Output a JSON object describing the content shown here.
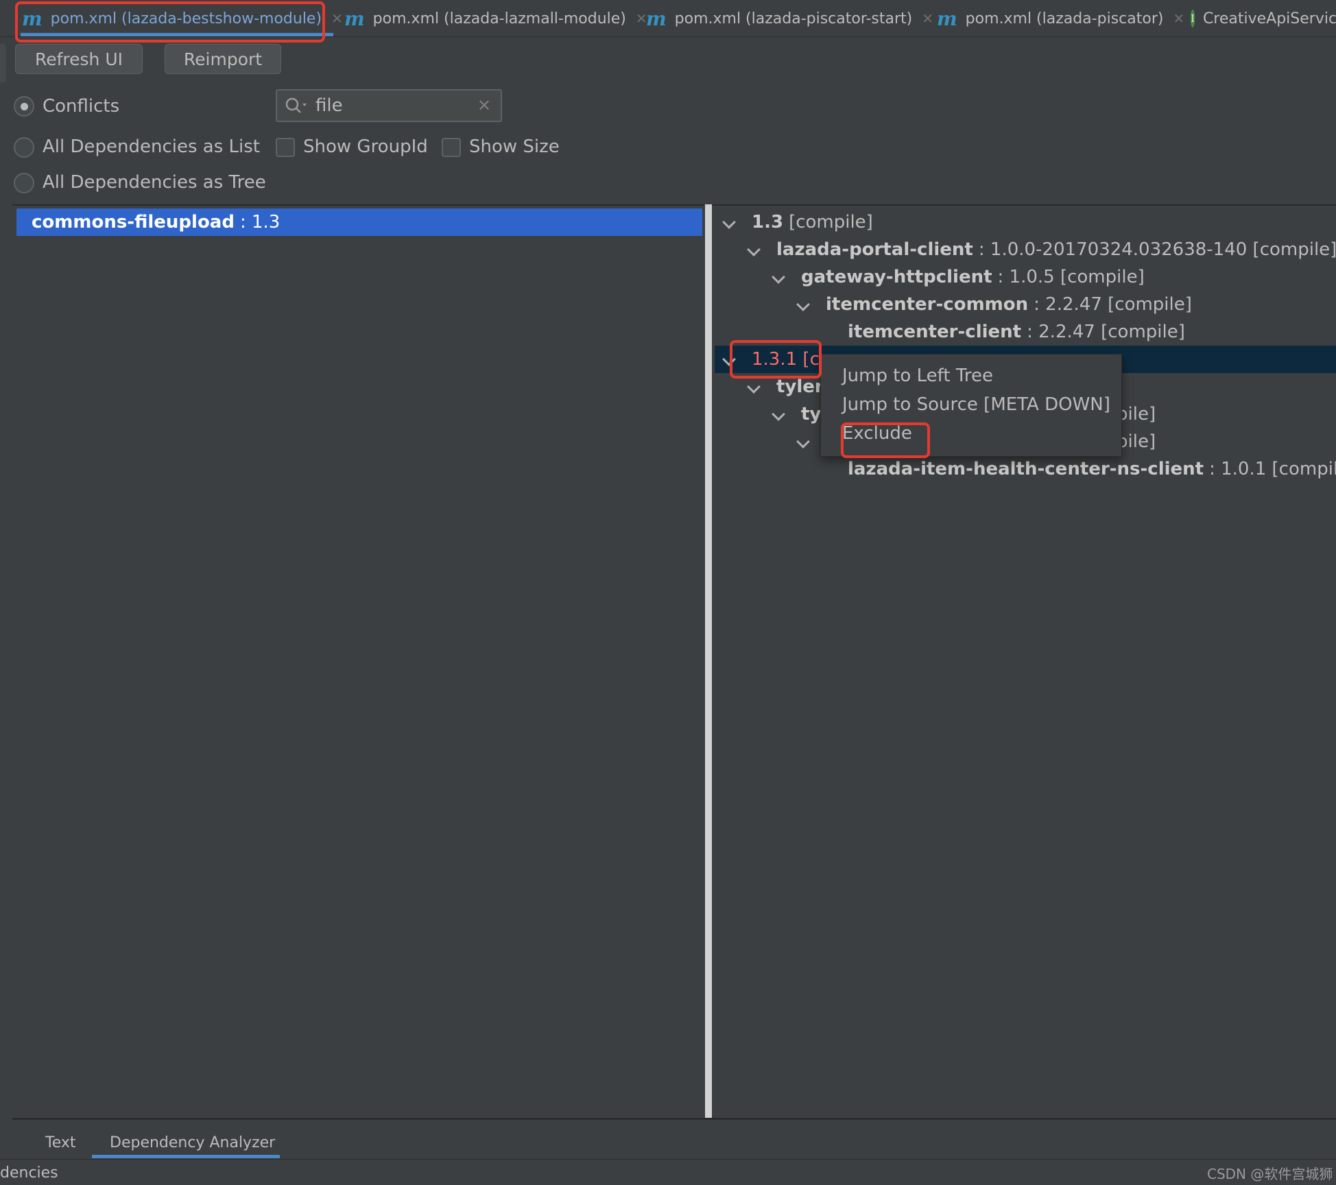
{
  "editor_tabs": [
    {
      "label": "pom.xml (lazada-bestshow-module)",
      "icon": "maven-icon",
      "active": true
    },
    {
      "label": "pom.xml (lazada-lazmall-module)",
      "icon": "maven-icon",
      "active": false
    },
    {
      "label": "pom.xml (lazada-piscator-start)",
      "icon": "maven-icon",
      "active": false
    },
    {
      "label": "pom.xml (lazada-piscator)",
      "icon": "maven-icon",
      "active": false
    },
    {
      "label": "CreativeApiServic",
      "icon": "interface-icon",
      "active": false
    }
  ],
  "icons": {
    "maven_glyph": "m",
    "interface_glyph": "I",
    "close_glyph": "✕"
  },
  "toolbar": {
    "refresh_label": "Refresh UI",
    "reimport_label": "Reimport"
  },
  "options": {
    "conflicts": "Conflicts",
    "list": "All Dependencies as List",
    "tree": "All Dependencies as Tree",
    "show_groupid": "Show GroupId",
    "show_size": "Show Size",
    "selected": "conflicts"
  },
  "search": {
    "value": "file",
    "placeholder": ""
  },
  "left_tree": {
    "selected_name": "commons-fileupload",
    "selected_version": ": 1.3"
  },
  "right_tree": {
    "rows": [
      {
        "name": "1.3",
        "suffix": "[compile]"
      },
      {
        "name": "lazada-portal-client",
        "suffix": ": 1.0.0-20170324.032638-140 [compile]"
      },
      {
        "name": "gateway-httpclient",
        "suffix": ": 1.0.5 [compile]"
      },
      {
        "name": "itemcenter-common",
        "suffix": ": 2.2.47 [compile]"
      },
      {
        "name": "itemcenter-client",
        "suffix": ": 2.2.47 [compile]"
      },
      {
        "name": "1.3.1 [co",
        "suffix": ""
      },
      {
        "name": "tyler-",
        "suffix": ""
      },
      {
        "name": "tyl",
        "suffix": ""
      },
      {
        "name": "",
        "suffix": ""
      },
      {
        "name": "lazada-item-health-center-ns-client",
        "suffix": ": 1.0.1 [compile]"
      }
    ],
    "partial_right": [
      "pile]",
      "pile]"
    ]
  },
  "context_menu": {
    "items": [
      "Jump to Left Tree",
      "Jump to Source [META DOWN]",
      "Exclude"
    ]
  },
  "bottom_tabs": [
    "Text",
    "Dependency Analyzer"
  ],
  "status": {
    "left": "dencies",
    "watermark": "CSDN @软件宫城狮"
  },
  "colors": {
    "accent": "#4a88c7",
    "selection": "#2f65ca",
    "conflict": "#ff6b68",
    "annotation": "#e53a30"
  }
}
